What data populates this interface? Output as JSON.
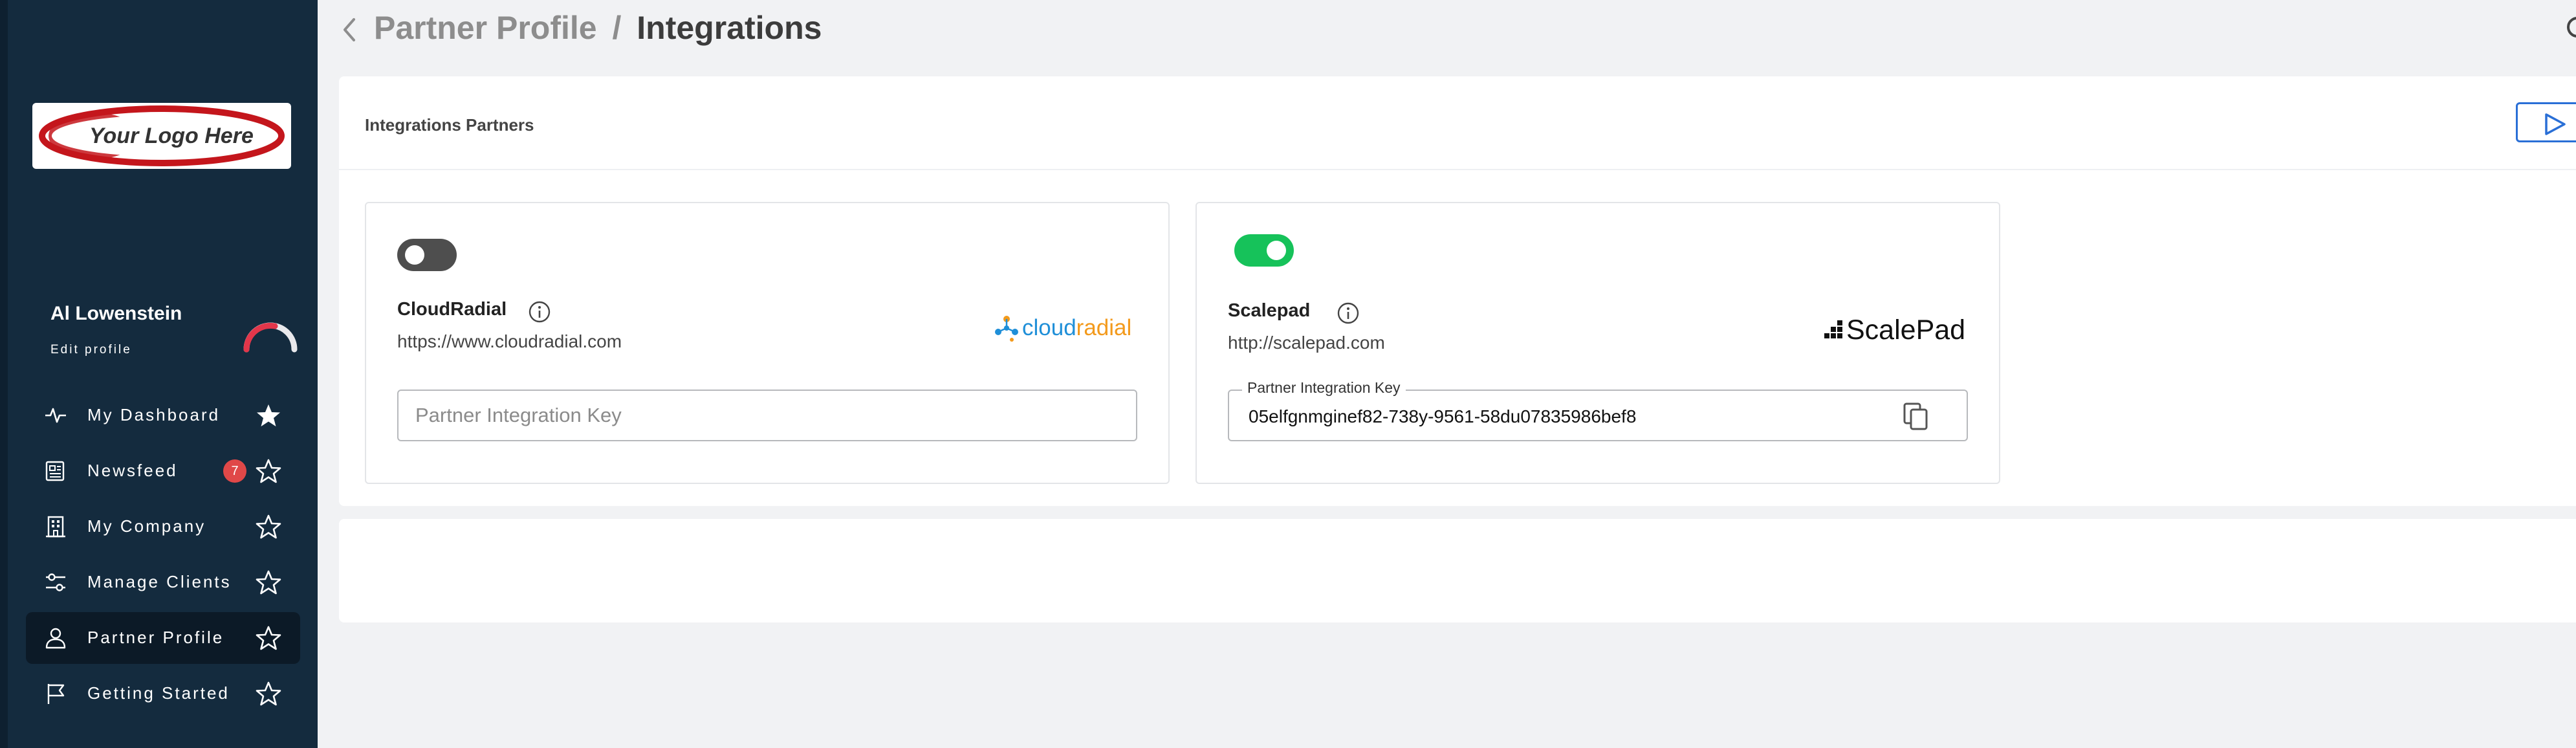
{
  "sidebar": {
    "logo_text": "Your Logo Here",
    "user": {
      "name": "Al Lowenstein",
      "edit_label": "Edit profile"
    },
    "items": [
      {
        "label": "My Dashboard",
        "icon": "pulse-icon",
        "favorited": true
      },
      {
        "label": "Newsfeed",
        "icon": "newspaper-icon",
        "badge": "7",
        "favorited": false
      },
      {
        "label": "My Company",
        "icon": "building-icon",
        "favorited": false
      },
      {
        "label": "Manage Clients",
        "icon": "sliders-icon",
        "favorited": false
      },
      {
        "label": "Partner Profile",
        "icon": "user-icon",
        "favorited": false,
        "active": true
      },
      {
        "label": "Getting Started",
        "icon": "flag-icon",
        "favorited": false
      }
    ]
  },
  "header": {
    "parent": "Partner Profile",
    "separator": "/",
    "current": "Integrations"
  },
  "panel": {
    "title": "Integrations Partners"
  },
  "cards": [
    {
      "name": "CloudRadial",
      "url": "https://www.cloudradial.com",
      "enabled": false,
      "logo_text": {
        "part1": "cloud",
        "part2": "radial"
      },
      "key_placeholder": "Partner Integration Key",
      "key_value": ""
    },
    {
      "name": "Scalepad",
      "url": "http://scalepad.com",
      "enabled": true,
      "logo_text": "ScalePad",
      "key_label": "Partner Integration Key",
      "key_value": "05elfgnmginef82-738y-9561-58du07835986bef8"
    }
  ],
  "colors": {
    "sidebar": "#142b3e",
    "toggle_on": "#16c25a",
    "toggle_off": "#4e4e4e",
    "badge": "#e04848",
    "accent_blue": "#2a6fd6",
    "cloudradial_blue": "#1f8fd8",
    "cloudradial_orange": "#f39a1c"
  }
}
